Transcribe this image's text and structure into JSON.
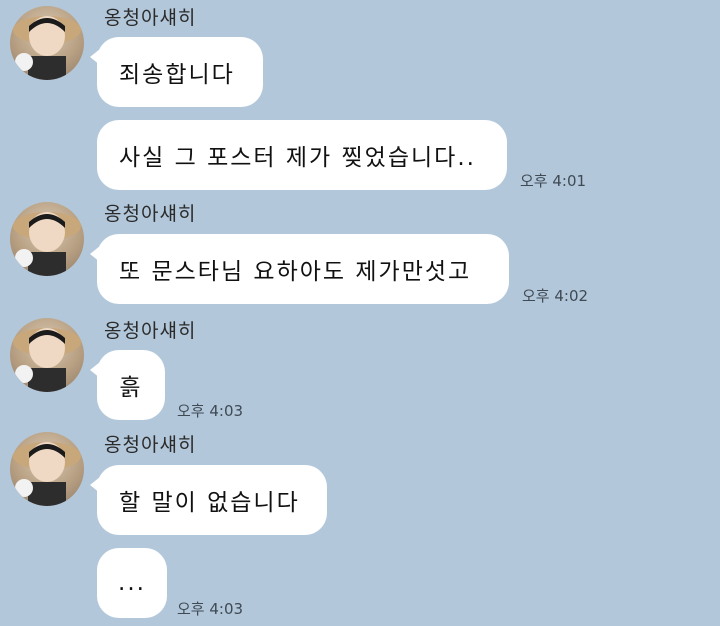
{
  "chat": {
    "sender_name": "옹청아섀히",
    "messages": [
      {
        "text": "죄송합니다"
      },
      {
        "text": "사실 그 포스터 제가 찢었습니다..",
        "time": "오후 4:01"
      },
      {
        "text": "또 문스타님 요하아도 제가만섯고",
        "time": "오후 4:02"
      },
      {
        "text": "흙",
        "time": "오후 4:03"
      },
      {
        "text": "할 말이 없습니다",
        "time": ""
      },
      {
        "text": "...",
        "time": "오후 4:03"
      }
    ]
  },
  "colors": {
    "background": "#b2c7da",
    "bubble": "#ffffff"
  },
  "icons": {
    "avatar": "profile-photo-straw-hat"
  }
}
